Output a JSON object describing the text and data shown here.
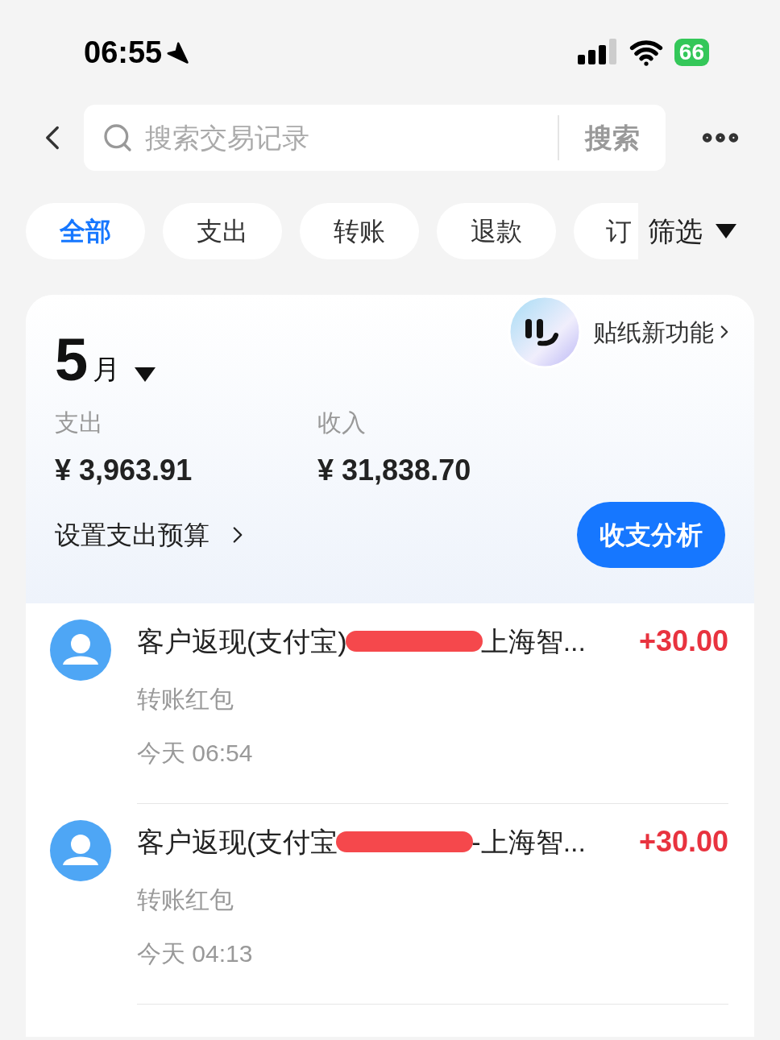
{
  "status_bar": {
    "time": "06:55",
    "battery": "66"
  },
  "search": {
    "placeholder": "搜索交易记录",
    "button": "搜索"
  },
  "chips": [
    {
      "label": "全部",
      "selected": true
    },
    {
      "label": "支出",
      "selected": false
    },
    {
      "label": "转账",
      "selected": false
    },
    {
      "label": "退款",
      "selected": false
    },
    {
      "label": "订",
      "selected": false
    }
  ],
  "filter": "筛选",
  "summary": {
    "month": "5",
    "month_unit": "月",
    "sticker_promo": "贴纸新功能",
    "expense_label": "支出",
    "expense": "¥ 3,963.91",
    "income_label": "收入",
    "income": "¥ 31,838.70",
    "budget_link": "设置支出预算",
    "analysis_button": "收支分析"
  },
  "transactions": [
    {
      "title_start": "客户返现(支付宝)",
      "title_end": "上海智...",
      "amount": "+30.00",
      "category": "转账红包",
      "time": "今天 06:54"
    },
    {
      "title_start": "客户返现(支付宝",
      "title_end": "-上海智...",
      "amount": "+30.00",
      "category": "转账红包",
      "time": "今天 04:13"
    }
  ]
}
